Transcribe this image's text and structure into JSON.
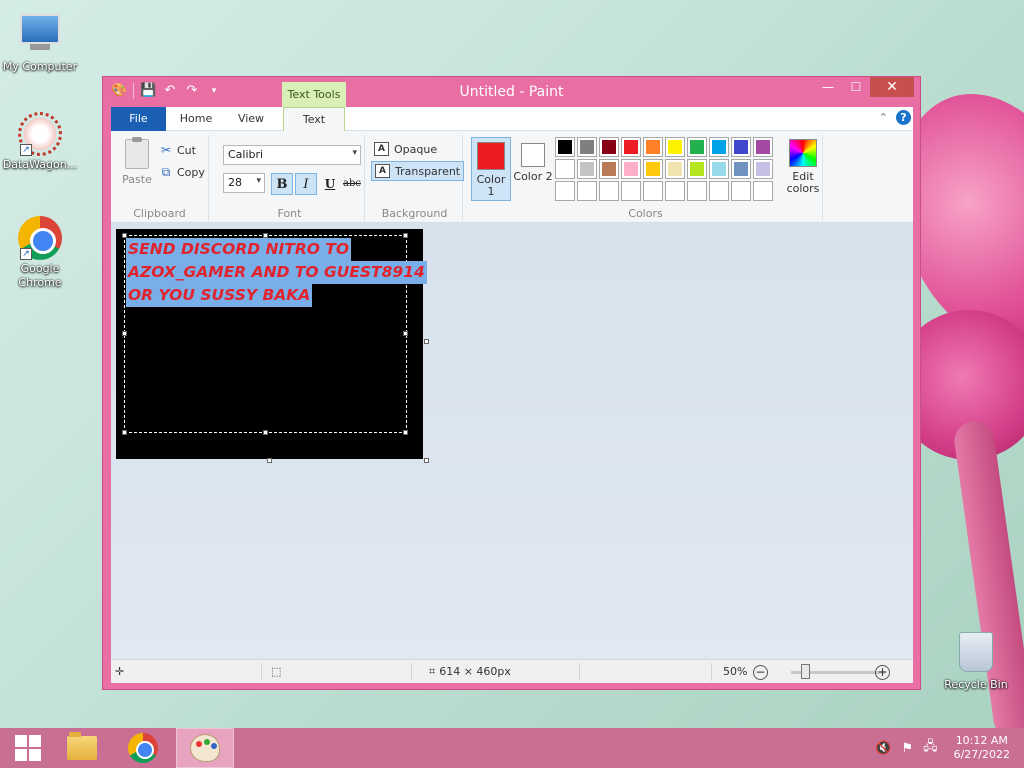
{
  "desktop": {
    "icons": [
      {
        "label": "My Computer"
      },
      {
        "label": "DataWagon..."
      },
      {
        "label": "Google Chrome"
      },
      {
        "label": "Recycle Bin"
      }
    ]
  },
  "window": {
    "title": "Untitled - Paint",
    "context_tab": "Text Tools",
    "minimize": "—",
    "maximize": "☐",
    "close": "✕"
  },
  "tabs": {
    "file": "File",
    "home": "Home",
    "view": "View",
    "text": "Text"
  },
  "ribbon": {
    "clipboard": {
      "label": "Clipboard",
      "paste": "Paste",
      "cut": "Cut",
      "copy": "Copy"
    },
    "font": {
      "label": "Font",
      "family": "Calibri",
      "size": "28",
      "bold": "B",
      "italic": "I",
      "underline": "U",
      "strike": "abc"
    },
    "background": {
      "label": "Background",
      "opaque": "Opaque",
      "transparent": "Transparent"
    },
    "colors": {
      "label": "Colors",
      "color1": "Color 1",
      "color2": "Color 2",
      "color1_value": "#ed1c24",
      "color2_value": "#ffffff",
      "edit": "Edit colors",
      "palette": [
        "#000000",
        "#7f7f7f",
        "#880015",
        "#ed1c24",
        "#ff7f27",
        "#fff200",
        "#22b14c",
        "#00a2e8",
        "#3f48cc",
        "#a349a4",
        "#ffffff",
        "#c3c3c3",
        "#b97a57",
        "#ffaec9",
        "#ffc90e",
        "#efe4b0",
        "#b5e61d",
        "#99d9ea",
        "#7092be",
        "#c8bfe7",
        "#ffffff",
        "#ffffff",
        "#ffffff",
        "#ffffff",
        "#ffffff",
        "#ffffff",
        "#ffffff",
        "#ffffff",
        "#ffffff",
        "#ffffff"
      ]
    }
  },
  "canvas": {
    "text_lines": [
      "SEND DISCORD NITRO TO",
      "AZOX_GAMER AND TO GUEST8914",
      "OR YOU SUSSY BAKA"
    ]
  },
  "status": {
    "dimensions": "614 × 460px",
    "zoom": "50%",
    "zoom_out": "−",
    "zoom_in": "+"
  },
  "taskbar": {
    "time": "10:12 AM",
    "date": "6/27/2022"
  }
}
